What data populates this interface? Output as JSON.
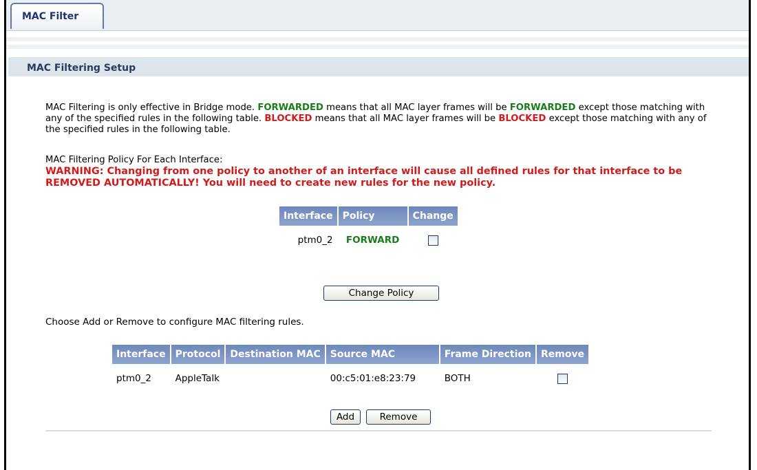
{
  "tab": {
    "label": "MAC Filter"
  },
  "section": {
    "title": "MAC Filtering Setup"
  },
  "description": {
    "p1": "MAC Filtering is only effective in Bridge mode. ",
    "forwarded1": "FORWARDED",
    "p2": " means that all MAC layer frames will be ",
    "forwarded2": "FORWARDED",
    "p3": " except those matching with any of the specified rules in the following table. ",
    "blocked1": "BLOCKED",
    "p4": " means that all MAC layer frames will be ",
    "blocked2": "BLOCKED",
    "p5": " except those matching with any of the specified rules in the following table."
  },
  "policy_label": "MAC Filtering Policy For Each Interface:",
  "warning": "WARNING: Changing from one policy to another of an interface will cause all defined rules for that interface to be REMOVED AUTOMATICALLY! You will need to create new rules for the new policy.",
  "policy_table": {
    "headers": [
      "Interface",
      "Policy",
      "Change"
    ],
    "rows": [
      {
        "interface": "ptm0_2",
        "policy": "FORWARD",
        "change_checked": false
      }
    ]
  },
  "change_policy_label": "Change Policy",
  "rules_intro": "Choose Add or Remove to configure MAC filtering rules.",
  "rules_table": {
    "headers": [
      "Interface",
      "Protocol",
      "Destination MAC",
      "Source MAC",
      "Frame Direction",
      "Remove"
    ],
    "rows": [
      {
        "interface": "ptm0_2",
        "protocol": "AppleTalk",
        "destination_mac": "",
        "source_mac": "00:c5:01:e8:23:79",
        "frame_direction": "BOTH",
        "remove_checked": false
      }
    ]
  },
  "buttons": {
    "add": "Add",
    "remove": "Remove"
  },
  "colors": {
    "header_bg": "#7a91c2",
    "green": "#1c7c1c",
    "red": "#d01c1c",
    "section_bg": "#dde5ec"
  }
}
